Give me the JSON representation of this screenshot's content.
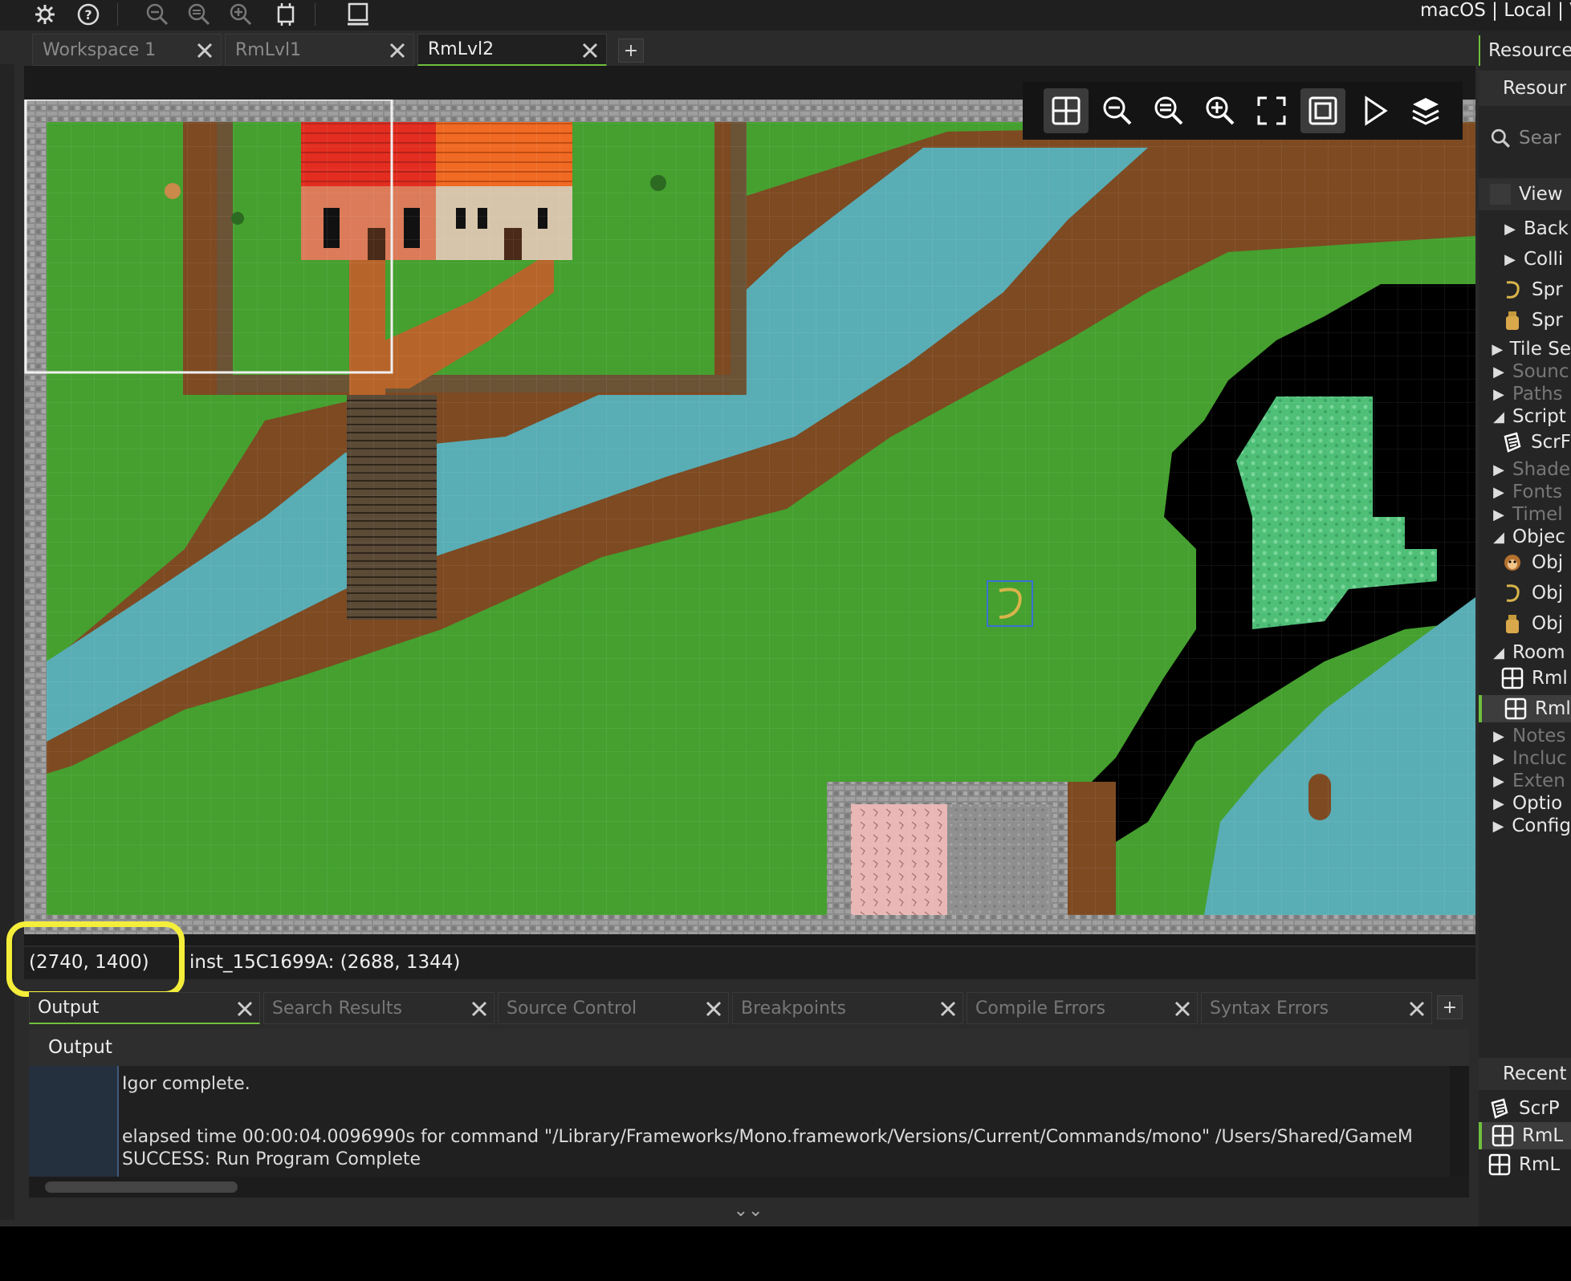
{
  "topbar": {
    "platform_label": "macOS | Local | V",
    "tools": [
      "settings-icon",
      "help-icon",
      "zoom-out-icon",
      "zoom-reset-icon",
      "zoom-in-icon",
      "resize-icon",
      "device-icon"
    ]
  },
  "doc_tabs": [
    {
      "label": "Workspace 1",
      "active": false
    },
    {
      "label": "RmLvl1",
      "active": false
    },
    {
      "label": "RmLvl2",
      "active": true
    }
  ],
  "add_tab_label": "+",
  "room_toolbar": [
    "grid-icon",
    "zoom-out-icon",
    "zoom-reset-icon",
    "zoom-in-icon",
    "fullscreen-icon",
    "fit-icon",
    "play-icon",
    "layers-icon"
  ],
  "status": {
    "cursor_coords": "(2740, 1400)",
    "instance_info": "inst_15C1699A: (2688, 1344)"
  },
  "output_tabs": [
    {
      "label": "Output",
      "active": true
    },
    {
      "label": "Search Results",
      "active": false
    },
    {
      "label": "Source Control",
      "active": false
    },
    {
      "label": "Breakpoints",
      "active": false
    },
    {
      "label": "Compile Errors",
      "active": false
    },
    {
      "label": "Syntax Errors",
      "active": false
    }
  ],
  "output": {
    "header": "Output",
    "lines": [
      "Igor complete.",
      "",
      "elapsed time 00:00:04.0096990s for command \"/Library/Frameworks/Mono.framework/Versions/Current/Commands/mono\" /Users/Shared/GameM",
      "SUCCESS: Run Program Complete"
    ]
  },
  "output_collapse_label": "⌄⌄",
  "resources": {
    "tab_label": "Resource",
    "title": "Resour",
    "search_placeholder": "Sear",
    "view_label": "View",
    "tree": [
      {
        "label": "Back",
        "kind": "child",
        "icon": "arrow"
      },
      {
        "label": "Colli",
        "kind": "child",
        "icon": "arrow"
      },
      {
        "label": "Spr",
        "kind": "child",
        "icon": "sprite-icon"
      },
      {
        "label": "Spr",
        "kind": "child",
        "icon": "bottle-icon"
      },
      {
        "label": "Tile Se",
        "kind": "group",
        "icon": "arrow"
      },
      {
        "label": "Sounc",
        "kind": "group-dim",
        "icon": "arrow"
      },
      {
        "label": "Paths",
        "kind": "group-dim",
        "icon": "arrow"
      },
      {
        "label": "Script",
        "kind": "group-open",
        "icon": "arrow"
      },
      {
        "label": "ScrF",
        "kind": "child",
        "icon": "script-icon"
      },
      {
        "label": "Shade",
        "kind": "group-dim",
        "icon": "arrow"
      },
      {
        "label": "Fonts",
        "kind": "group-dim",
        "icon": "arrow"
      },
      {
        "label": "Timel",
        "kind": "group-dim",
        "icon": "arrow"
      },
      {
        "label": "Objec",
        "kind": "group-open",
        "icon": "arrow"
      },
      {
        "label": "Obj",
        "kind": "child",
        "icon": "monkey-icon"
      },
      {
        "label": "Obj",
        "kind": "child",
        "icon": "sprite-icon"
      },
      {
        "label": "Obj",
        "kind": "child",
        "icon": "bottle-icon"
      },
      {
        "label": "Room",
        "kind": "group-open",
        "icon": "arrow"
      },
      {
        "label": "Rml",
        "kind": "child",
        "icon": "room-icon"
      },
      {
        "label": "Rml",
        "kind": "child-sel",
        "icon": "room-icon"
      },
      {
        "label": "Notes",
        "kind": "group-dim",
        "icon": "arrow"
      },
      {
        "label": "Incluc",
        "kind": "group-dim",
        "icon": "arrow"
      },
      {
        "label": "Exten",
        "kind": "group-dim",
        "icon": "arrow"
      },
      {
        "label": "Optio",
        "kind": "group",
        "icon": "arrow"
      },
      {
        "label": "Config",
        "kind": "group",
        "icon": "arrow"
      }
    ],
    "recent_title": "Recent",
    "recent": [
      {
        "label": "ScrP",
        "icon": "script-icon"
      },
      {
        "label": "RmL",
        "icon": "room-icon"
      },
      {
        "label": "RmL",
        "icon": "room-icon"
      }
    ]
  },
  "colors": {
    "grass": "#45a02f",
    "dirt": "#7d4a22",
    "water": "#59adb5",
    "wall": "#8d8d8d",
    "accent": "#6fbf3e",
    "highlight": "#f4ee3a"
  }
}
